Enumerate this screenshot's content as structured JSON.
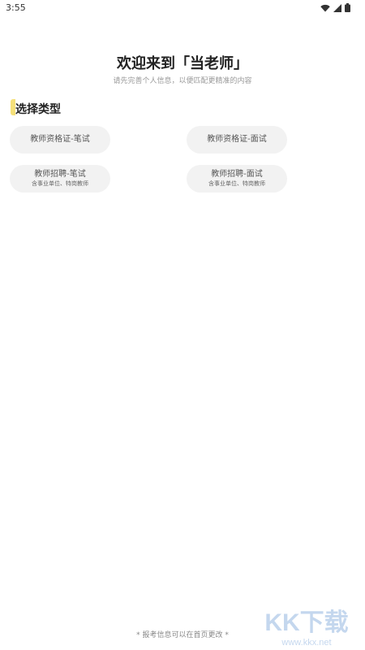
{
  "status_bar": {
    "time": "3:55",
    "icons": [
      "wifi-icon",
      "signal-icon",
      "battery-icon"
    ]
  },
  "header": {
    "title": "欢迎来到「当老师」",
    "subtitle": "请先完善个人信息，以便匹配更精准的内容"
  },
  "section": {
    "title": "选择类型",
    "accent_color": "#f5e07a"
  },
  "options": [
    {
      "label": "教师资格证-笔试",
      "sub": ""
    },
    {
      "label": "教师资格证-面试",
      "sub": ""
    },
    {
      "label": "教师招聘-笔试",
      "sub": "含事业单位、特岗教师"
    },
    {
      "label": "教师招聘-面试",
      "sub": "含事业单位、特岗教师"
    }
  ],
  "footer": {
    "note": "* 报考信息可以在首页更改 *"
  },
  "watermark": {
    "logo_text": "KK下载",
    "url": "www.kkx.net"
  }
}
